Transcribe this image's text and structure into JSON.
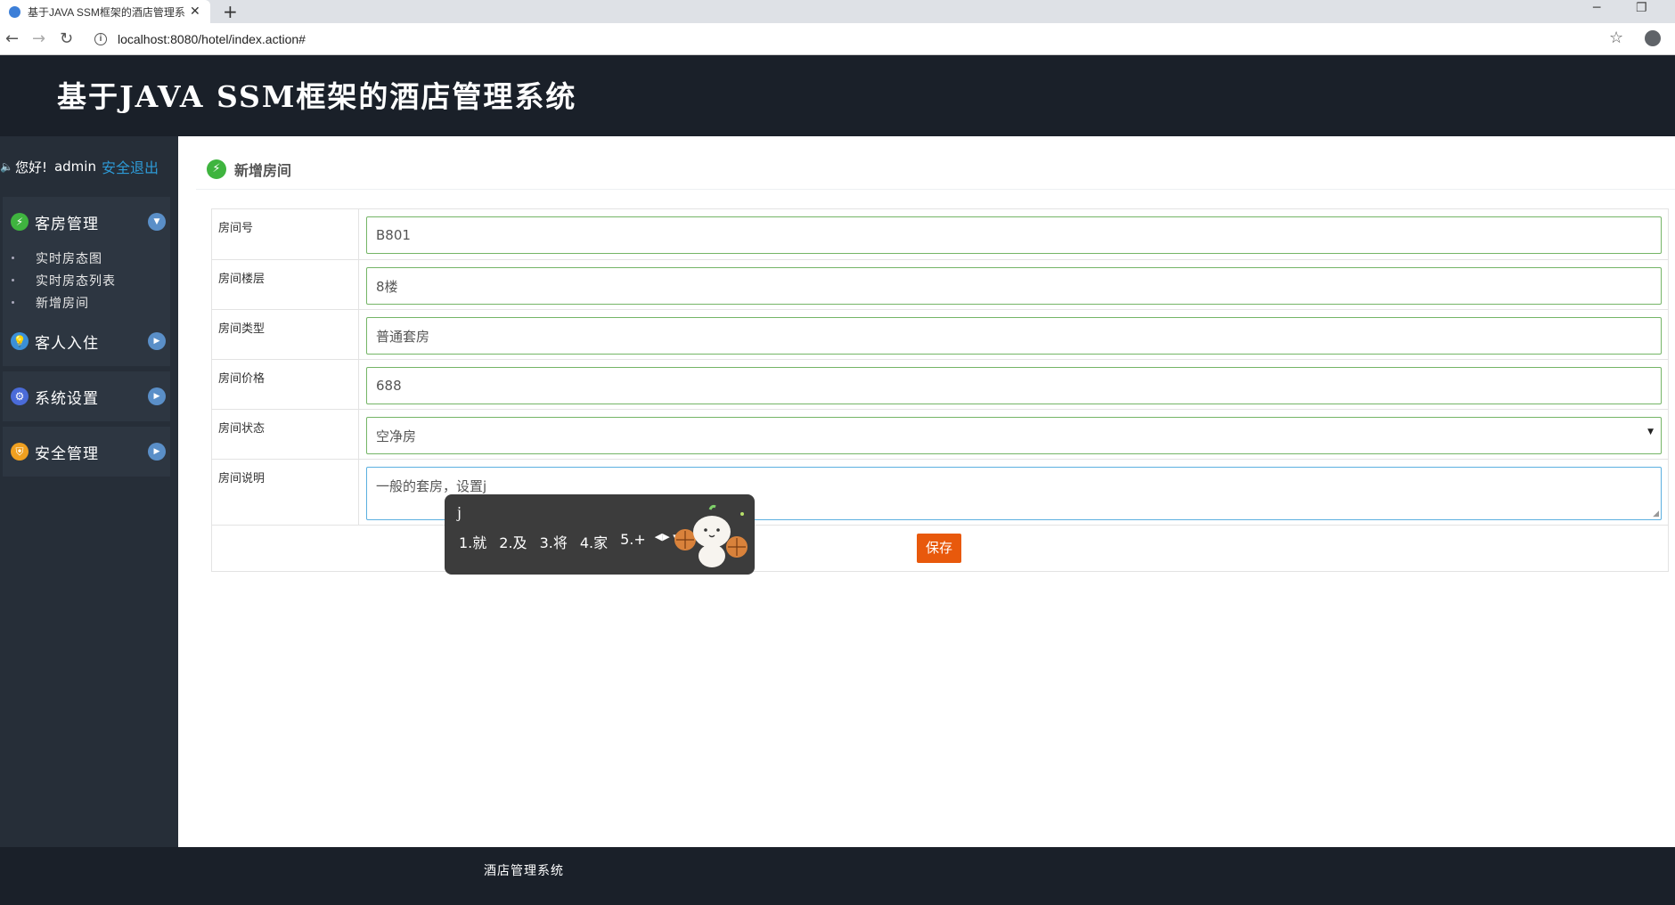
{
  "browser": {
    "tab_title": "基于JAVA SSM框架的酒店管理系",
    "tab_close": "✕",
    "new_tab": "+",
    "url": "localhost:8080/hotel/index.action#",
    "controls": {
      "minimize": "─",
      "restore": "❐"
    }
  },
  "header": {
    "title": "基于JAVA SSM框架的酒店管理系统"
  },
  "sidebar": {
    "greeting": "您好!",
    "username": "admin",
    "logout_label": "安全退出",
    "groups": [
      {
        "label": "客房管理",
        "icon": "bolt-icon",
        "icon_color": "#3fb43f",
        "expanded": true,
        "items": [
          {
            "label": "实时房态图"
          },
          {
            "label": "实时房态列表"
          },
          {
            "label": "新增房间"
          }
        ]
      },
      {
        "label": "客人入住",
        "icon": "lightbulb-icon",
        "icon_color": "#3a8fd8",
        "expanded": false,
        "items": []
      },
      {
        "label": "系统设置",
        "icon": "gears-icon",
        "icon_color": "#4a6bd8",
        "expanded": false,
        "items": []
      },
      {
        "label": "安全管理",
        "icon": "shield-icon",
        "icon_color": "#f0a020",
        "expanded": false,
        "items": []
      }
    ]
  },
  "page": {
    "title": "新增房间",
    "form": {
      "room_number": {
        "label": "房间号",
        "value": "B801"
      },
      "floor": {
        "label": "房间楼层",
        "value": "8楼"
      },
      "type": {
        "label": "房间类型",
        "value": "普通套房"
      },
      "price": {
        "label": "房间价格",
        "value": "688"
      },
      "status": {
        "label": "房间状态",
        "value": "空净房"
      },
      "description": {
        "label": "房间说明",
        "value": "一般的套房，设置j"
      }
    },
    "save_label": "保存"
  },
  "ime": {
    "input": "j",
    "candidates": [
      "1.就",
      "2.及",
      "3.将",
      "4.家",
      "5.+"
    ]
  },
  "footer": {
    "text": "酒店管理系统"
  },
  "colors": {
    "header_bg": "#1a2029",
    "sidebar_bg": "#262e38",
    "field_border": "#74b566",
    "focus_border": "#5bb0e0",
    "save_button": "#e8590c",
    "link": "#2d9ad6"
  }
}
